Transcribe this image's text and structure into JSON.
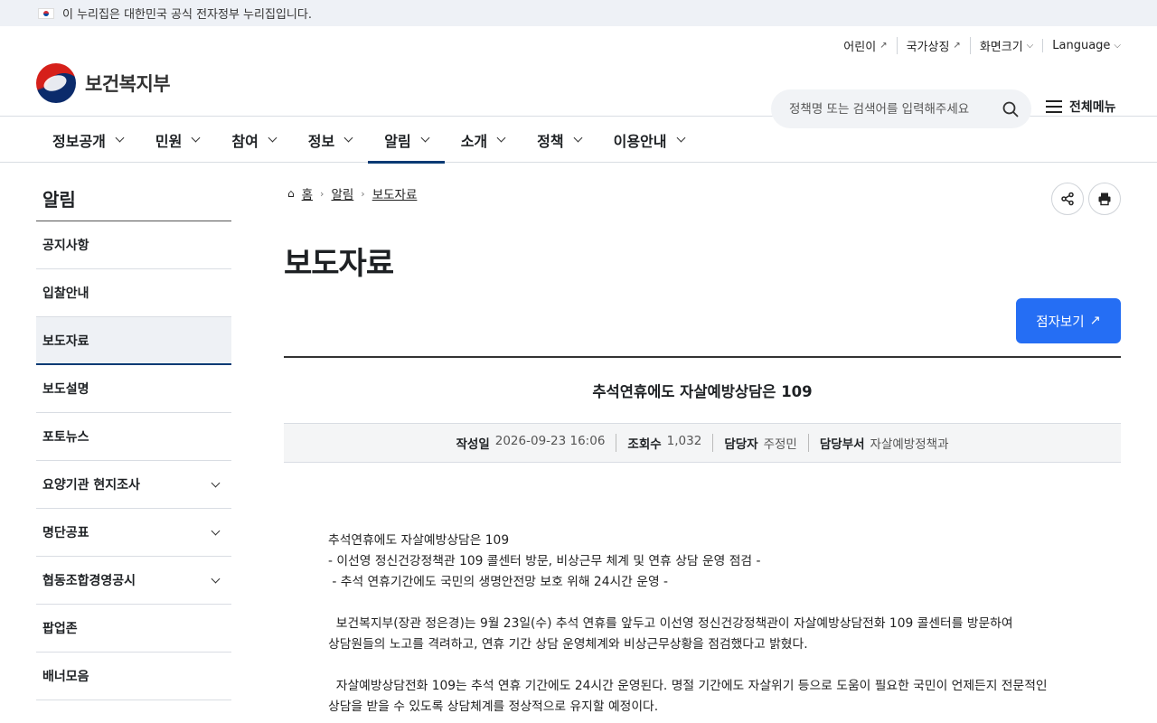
{
  "gov_bar": {
    "text": "이 누리집은 대한민국 공식 전자정부 누리집입니다."
  },
  "util": [
    {
      "label": "어린이",
      "icon": "external-link-icon"
    },
    {
      "label": "국가상징",
      "icon": "external-link-icon"
    },
    {
      "label": "화면크기",
      "icon": "chevron-down-icon"
    },
    {
      "label": "Language",
      "icon": "chevron-down-icon"
    }
  ],
  "logo": {
    "name": "보건복지부"
  },
  "search": {
    "placeholder": "정책명 또는 검색어를 입력해주세요"
  },
  "all_menu": {
    "label": "전체메뉴"
  },
  "gnb": [
    "정보공개",
    "민원",
    "참여",
    "정보",
    "알림",
    "소개",
    "정책",
    "이용안내"
  ],
  "gnb_active": "알림",
  "lnb": {
    "title": "알림",
    "items": [
      {
        "label": "공지사항",
        "expandable": false
      },
      {
        "label": "입찰안내",
        "expandable": false
      },
      {
        "label": "보도자료",
        "expandable": false,
        "active": true
      },
      {
        "label": "보도설명",
        "expandable": false
      },
      {
        "label": "포토뉴스",
        "expandable": false
      },
      {
        "label": "요양기관 현지조사",
        "expandable": true
      },
      {
        "label": "명단공표",
        "expandable": true
      },
      {
        "label": "협동조합경영공시",
        "expandable": true
      },
      {
        "label": "팝업존",
        "expandable": false
      },
      {
        "label": "배너모음",
        "expandable": false
      }
    ]
  },
  "breadcrumb": {
    "home": "홈",
    "level1": "알림",
    "level2": "보도자료"
  },
  "page_title": "보도자료",
  "braille_button": "점자보기",
  "article": {
    "title": "추석연휴에도 자살예방상담은 109",
    "meta": [
      {
        "key": "작성일",
        "value": "2026-09-23 16:06"
      },
      {
        "key": "조회수",
        "value": "1,032"
      },
      {
        "key": "담당자",
        "value": "주정민"
      },
      {
        "key": "담당부서",
        "value": "자살예방정책과"
      }
    ],
    "body": {
      "line1": "추석연휴에도 자살예방상담은 109",
      "line2": "- 이선영 정신건강정책관 109 콜센터 방문, 비상근무 체계 및 연휴 상담 운영 점검 -",
      "line3": " - 추석 연휴기간에도 국민의 생명안전망 보호 위해 24시간 운영 -",
      "para1": "  보건복지부(장관 정은경)는 9월 23일(수) 추석 연휴를 앞두고 이선영 정신건강정책관이 자살예방상담전화 109 콜센터를 방문하여\n상담원들의 노고를 격려하고, 연휴 기간 상담 운영체계와 비상근무상황을 점검했다고 밝혔다.",
      "para2": "  자살예방상담전화 109는 추석 연휴 기간에도 24시간 운영된다. 명절 기간에도 자살위기 등으로 도움이 필요한 국민이 언제든지 전문적인\n상담을 받을 수 있도록 상담체계를 정상적으로 유지할 예정이다."
    }
  }
}
